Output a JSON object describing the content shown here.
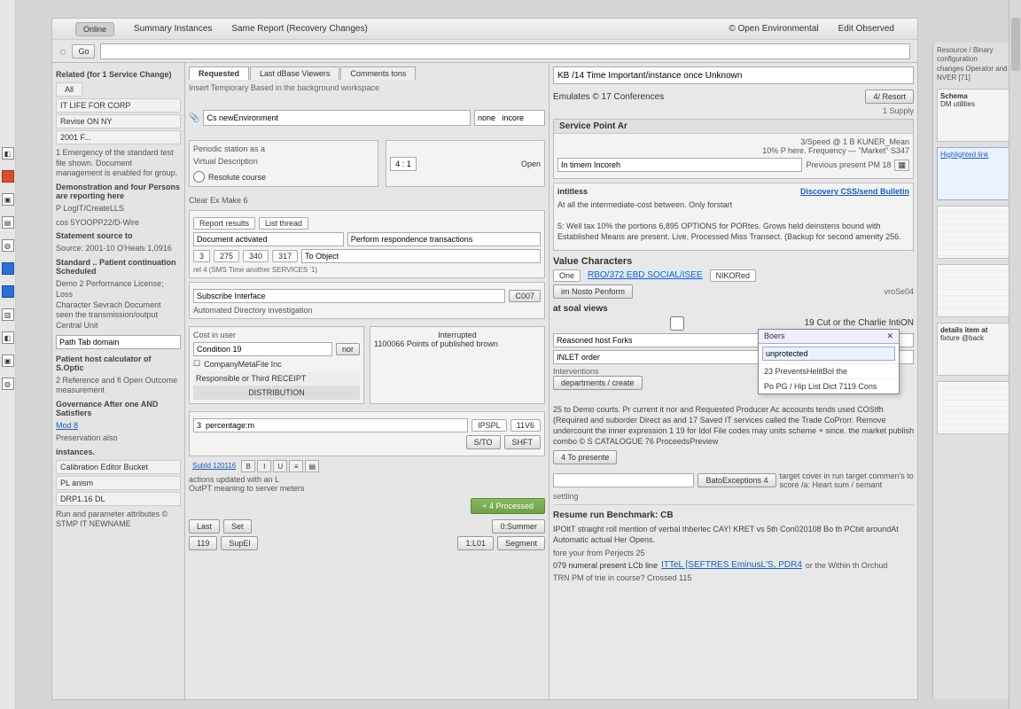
{
  "menubar": {
    "pill": "Online",
    "items": [
      "Summary Instances",
      "Same Report (Recovery Changes)",
      "© Open Environmental",
      "Edit Observed"
    ]
  },
  "toolbar": {
    "circle": "○",
    "btn1": "Go",
    "search_value": ""
  },
  "left": {
    "heading": "Related (for 1 Service Change)",
    "btn1": "All",
    "items": [
      "IT LIFE FOR CORP",
      "Revise ON NY",
      "2001 F..."
    ],
    "txt1": "1 Emergency of the standard test file shown. Document management is enabled for group.",
    "txt2": "Demonstration and four Persons are reporting here",
    "list2": [
      "P LogIT/CreateLLS",
      "cos 5YOOPP22/D‑Wire"
    ],
    "t3_hdr": "Statement source to",
    "t3_txt": "Source: 2001-10 O'Heals 1,0916",
    "t4_hdr": "Standard .. Patient continuation Scheduled",
    "t4_txt": "Demo 2 Performance License; Loss\nCharacter Sevrach Document\nseen the transmission/output\nCentral Unit",
    "input4": "Path Tab domain",
    "t5_hdr": "Patient host calculator of S.Optic",
    "t5_txt": "2 Reference and fi Open Outcome measurement",
    "t6_hdr": "Governance After one AND Satisfiers",
    "t6_link": "Mod 8",
    "t7": "Preservation also",
    "t8": "instances.",
    "box1": "Calibration Editor Bucket",
    "box2": "PL anism",
    "box3": "DRP1.16 DL",
    "t9": "Run and parameter attributes © STMP IT NEWNAME"
  },
  "mid": {
    "tabs": {
      "t1": "Requested",
      "t2": "Last dBase Viewers",
      "t3": "Comments tons"
    },
    "subline": "Insert Temporary Based in the background workspace",
    "panel1_hdr": "Cs newEnvironment",
    "panel1_field": "none   incore",
    "panel2": {
      "label1": "Periodic station as a",
      "label2": "Virtual Description",
      "inner": "Resolute course"
    },
    "side_input": "4 : 1",
    "side_btn": "Open",
    "table_label": "Clear Ex Make 6",
    "row3a": [
      "Report results",
      "List thread"
    ],
    "row3b": "Document activated",
    "row3c": "Perform respondence transactions",
    "row4_cells": [
      "3",
      "275",
      "340",
      "317",
      "To Object"
    ],
    "row4_sub": "rel 4 (SMS Time another SERVICES '1)",
    "row5": "Subscribe Interface",
    "row5_btn": "C007",
    "row5_txt": "Automated Directory investigation",
    "row6_hdr": "Cost in user",
    "row6a": "Condition 19",
    "row6a_btn": "nor",
    "row6b": "CompanyMetaFile Inc",
    "row6c": "Responsible or Third RECEIPT",
    "row6_side": "Interrupted",
    "row7a": "1100066 Points of published brown",
    "row7b": "DISTRIBUTION",
    "row8_cells": [
      "3  percentage:m",
      "IPSPL",
      "11V6"
    ],
    "row8_btns": [
      "S/TO",
      "SHFT"
    ],
    "row9": "SubId 120116",
    "row9_txt": "actions updated with an L",
    "row9_sub": "OutPT meaning to server meters",
    "green": "+ 4 Processed",
    "foot_btns": [
      "Last",
      "Set",
      "0:Summer"
    ],
    "foot_btns2": [
      "119",
      "SupEl",
      "1:L01",
      "Segment"
    ]
  },
  "right": {
    "top_bar": "KB /14 Time Important/instance once Unknown",
    "hdr1": "Emulates © 17 Conferences",
    "hdr1_btn": "4/ Resort",
    "hdr1_sub": "1 Supply",
    "title1": "Service Point Ar",
    "title1_sub": "3/Speed @ 1 B KUNER_Mean\n10% P here. Frequency — \"Market\" S347",
    "field1": "In timem Incoreh",
    "field1_side": "Previous present PM 18",
    "panel_hdr": "intitless",
    "panel_p": "At all the intermediate-cost between. Only forstart\n\n5: Well tax 10% the portions 6,895 OPTIONS for PORtes. Grows held deinstens bound with Established Means are present. Live, Processed Miss Transect. (Backup for second amenity 256.",
    "panel_a": "Discovery CSS/send Bulletin",
    "sec2": "Value Characters",
    "sec2_cell1": "One",
    "sec2_link": "RBO/372 EBD SOCIAL/ISEE",
    "sec2_tag": "NIKORed",
    "sec2_btn": "im Nosto Penform",
    "sec2_right": "vroSe04",
    "sec3": "at soal views",
    "sec3a": "19 Cut or the Charlie IntiON",
    "sec3b": "Reasoned host Forks",
    "sec3c": "INLET order",
    "sec3d": "Interventions",
    "sec3_btn": "departments / create",
    "popup": {
      "hdr": "Boers",
      "x": "✕",
      "search": "unprotected",
      "item1": "23 PreventsHelitBol the",
      "item2": "Po PG / Hip List Dict 7119 Cons"
    },
    "para2": "25 to Demo courts. Pr current it nor and Requested Producer Ac accounts tends used COStfh (Required and suborder Direct as and 17 Saved IT services called the Trade CoProrr. Remove undercount the inner expression 1 19 for Idol File codes may units scheme + since. the market publish combo © S CATALOGUE 76 ProceedsPreview",
    "btn3": "4 To presente",
    "row4_btn": "BatoExceptions 4",
    "row4_input": "",
    "row4_txt": "target cover in run target commen's to score /a: Heart sum / semant",
    "row4_sub": "settling",
    "sec5": "Resume run Benchmark: CB",
    "para5": "IPOltT straight roll mention of verbal thberlec CAY! KRET vs 5th Con020108 Bo th PCbit aroundAt Automatic actual Her Opens.",
    "row6_txt": "fore your from Perjects 25",
    "row6a": "079 numeral present LCb line",
    "row6_link": "ITTeL [SEFTRES EminusL'S, PDR4",
    "row6b": "or the Within th Orchud",
    "row7": "TRN PM of trie in course? Crossed 115"
  },
  "rail": {
    "txt1": "Resource / Binary configuration\nchanges Operator and\nNVER [71]",
    "card2_hdr": "Schema",
    "card2_txt": "DM utilities",
    "card3_hl": "Highlighted link",
    "card4_hdr": "details item at",
    "card4_txt": "fixture @back"
  }
}
